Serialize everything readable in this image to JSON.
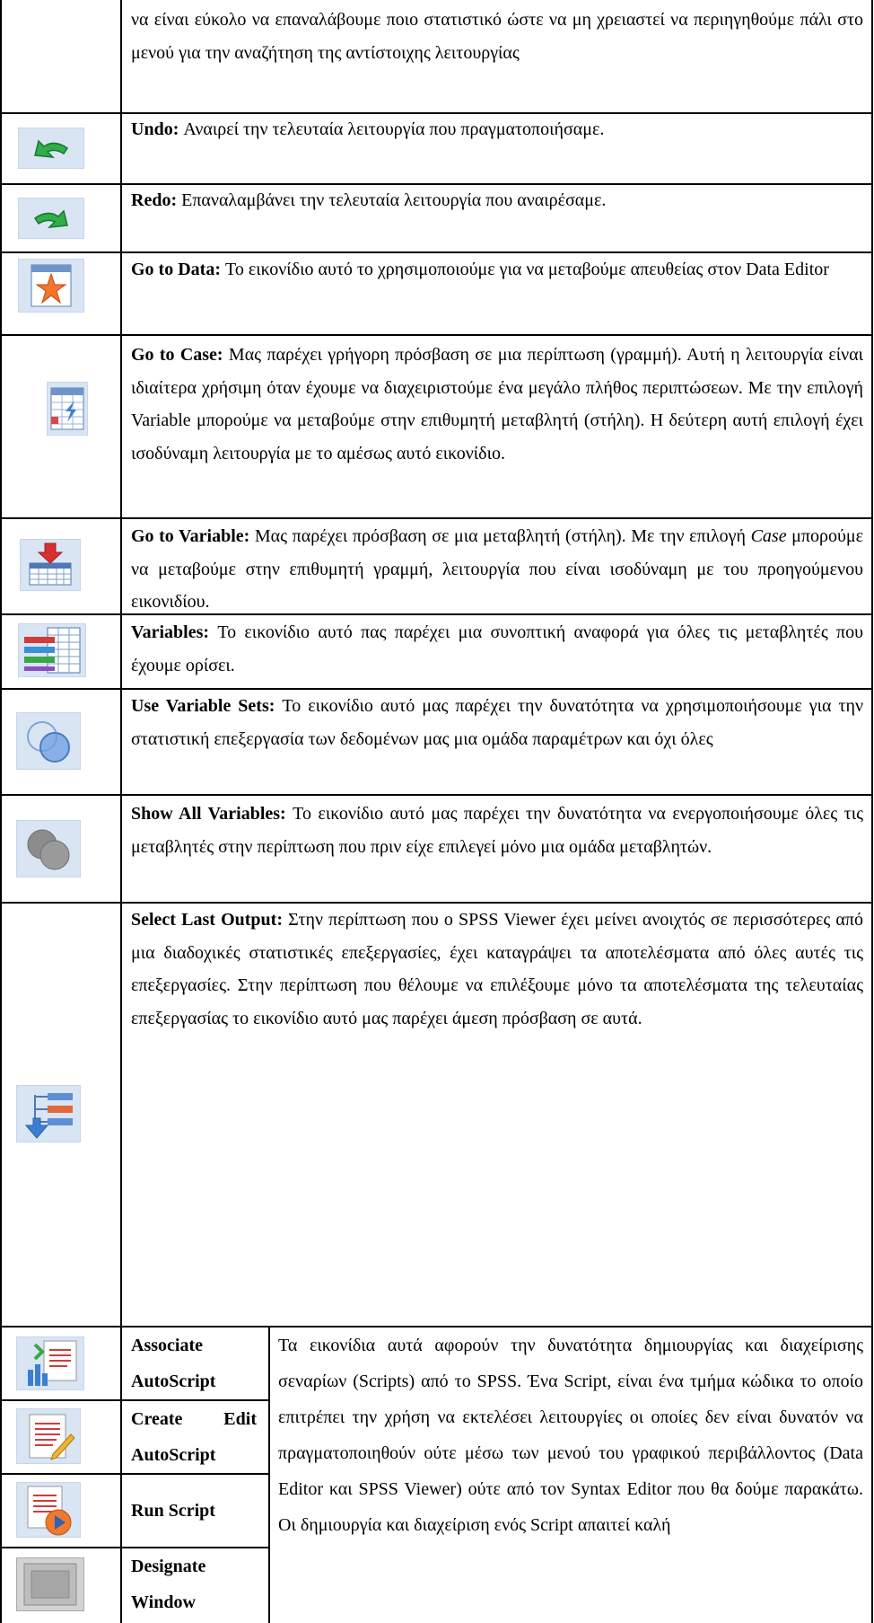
{
  "rows": [
    {
      "id": "cont",
      "icon": "",
      "text": "να είναι εύκολο να επαναλάβουμε ποιο στατιστικό ώστε να μη χρειαστεί να περιηγηθούμε πάλι στο μενού για την αναζήτηση της αντίστοιχης λειτουργίας"
    },
    {
      "id": "undo",
      "icon": "undo-icon",
      "title": "Undo:",
      "text": "Αναιρεί την τελευταία λειτουργία που πραγματοποιήσαμε."
    },
    {
      "id": "redo",
      "icon": "redo-icon",
      "title": "Redo:",
      "text": "Επαναλαμβάνει την τελευταία λειτουργία που αναιρέσαμε."
    },
    {
      "id": "go-to-data",
      "icon": "go-to-data-icon",
      "title": "Go to Data:",
      "text": "Το εικονίδιο αυτό το χρησιμοποιούμε για να μεταβούμε απευθείας στον Data Editor"
    },
    {
      "id": "go-to-case",
      "icon": "go-to-case-icon",
      "title": "Go to Case:",
      "text": "Μας παρέχει γρήγορη πρόσβαση σε μια περίπτωση (γραμμή). Αυτή η λειτουργία είναι ιδιαίτερα χρήσιμη όταν έχουμε να διαχειριστούμε ένα μεγάλο πλήθος περιπτώσεων. Με την επιλογή Variable μπορούμε να μεταβούμε στην επιθυμητή μεταβλητή (στήλη). Η δεύτερη αυτή επιλογή έχει ισοδύναμη λειτουργία με το αμέσως αυτό εικονίδιο."
    },
    {
      "id": "go-to-variable",
      "icon": "go-to-variable-icon",
      "title": "Go to Variable:",
      "text_before": "Μας παρέχει πρόσβαση σε μια μεταβλητή (στήλη). Με την επιλογή",
      "text_italic": "Case",
      "text_after": "μπορούμε να μεταβούμε στην επιθυμητή γραμμή, λειτουργία που είναι ισοδύναμη με του προηγούμενου εικονιδίου."
    },
    {
      "id": "variables",
      "icon": "variables-icon",
      "title": "Variables:",
      "text": "Το εικονίδιο αυτό πας παρέχει μια συνοπτική αναφορά για όλες τις μεταβλητές που έχουμε ορίσει."
    },
    {
      "id": "use-variable-sets",
      "icon": "use-variable-sets-icon",
      "title": "Use Variable Sets:",
      "text": "Το εικονίδιο αυτό μας παρέχει την δυνατότητα να χρησιμοποιήσουμε για την στατιστική επεξεργασία των δεδομένων μας μια ομάδα παραμέτρων και όχι όλες"
    },
    {
      "id": "show-all-variables",
      "icon": "show-all-variables-icon",
      "title": "Show All Variables:",
      "text": "Το εικονίδιο αυτό μας παρέχει την δυνατότητα να ενεργοποιήσουμε όλες τις μεταβλητές στην περίπτωση που πριν είχε επιλεγεί μόνο μια ομάδα μεταβλητών."
    },
    {
      "id": "select-last-output",
      "icon": "select-last-output-icon",
      "title": "Select Last Output:",
      "text": "Στην περίπτωση που ο SPSS Viewer έχει μείνει ανοιχτός σε περισσότερες από μια διαδοχικές στατιστικές επεξεργασίες, έχει καταγράψει τα αποτελέσματα από όλες αυτές τις επεξεργασίες. Στην περίπτωση που θέλουμε να επιλέξουμε μόνο τα αποτελέσματα της τελευταίας επεξεργασίας το εικονίδιο αυτό μας παρέχει άμεση πρόσβαση σε αυτά."
    }
  ],
  "script_rows": [
    {
      "id": "associate-autoscript",
      "icon": "associate-autoscript-icon",
      "label": "Associate AutoScript"
    },
    {
      "id": "create-edit-autoscript",
      "icon": "create-edit-autoscript-icon",
      "label": "Create Edit AutoScript"
    },
    {
      "id": "run-script",
      "icon": "run-script-icon",
      "label": "Run Script"
    },
    {
      "id": "designate-window",
      "icon": "designate-window-icon",
      "label": "Designate Window"
    }
  ],
  "scripts_text": "Τα εικονίδια αυτά αφορούν την δυνατότητα δημιουργίας και διαχείρισης σεναρίων (Scripts) από το SPSS. Ένα Script, είναι ένα τμήμα κώδικα το οποίο επιτρέπει την χρήση να εκτελέσει λειτουργίες οι οποίες δεν είναι δυνατόν να πραγματοποιηθούν ούτε μέσω των μενού του γραφικού περιβάλλοντος (Data Editor και SPSS Viewer) ούτε από τον Syntax Editor που θα δούμε παρακάτω. Οι δημιουργία και διαχείριση ενός Script απαιτεί καλή"
}
